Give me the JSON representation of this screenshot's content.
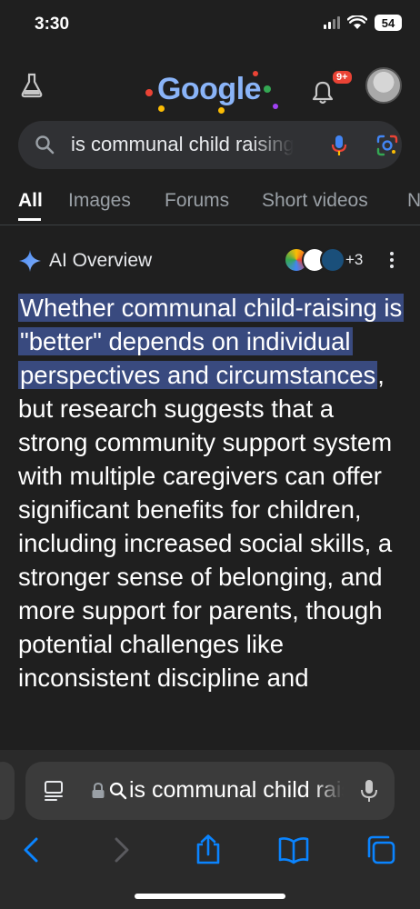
{
  "status_bar": {
    "time": "3:30",
    "battery": "54"
  },
  "header": {
    "doodle_text": "Google",
    "notification_badge": "9+"
  },
  "search": {
    "query": "is communal child raising"
  },
  "tabs": [
    {
      "label": "All",
      "active": true
    },
    {
      "label": "Images",
      "active": false
    },
    {
      "label": "Forums",
      "active": false
    },
    {
      "label": "Short videos",
      "active": false
    },
    {
      "label": "N",
      "active": false
    }
  ],
  "ai_overview": {
    "title": "AI Overview",
    "more_sources": "+3",
    "highlighted_text": "Whether communal child-raising is \"better\" depends on individual perspectives and circumstances",
    "body_text": ", but research suggests that a strong community support system with multiple caregivers can offer significant benefits for children, including increased social skills, a stronger sense of belonging, and more support for parents, though potential challenges like inconsistent discipline and"
  },
  "browser": {
    "address_text": "is communal child raising"
  },
  "colors": {
    "background": "#1f1f1f",
    "highlight": "#394a7f",
    "accent_blue": "#8ab4f8",
    "ios_blue": "#0a84ff",
    "badge_red": "#ea4335"
  },
  "icons": {
    "lab": "flask-icon",
    "notifications": "bell-icon",
    "search": "search-icon",
    "voice": "mic-icon",
    "visual_search": "lens-icon",
    "ai": "sparkle-icon",
    "more": "more-vert-icon",
    "tabs": "tabs-icon",
    "secure": "lock-icon",
    "back": "chevron-left-icon",
    "forward": "chevron-right-icon",
    "share": "share-icon",
    "bookmarks": "book-icon",
    "tab_switcher": "tabs-overview-icon"
  }
}
